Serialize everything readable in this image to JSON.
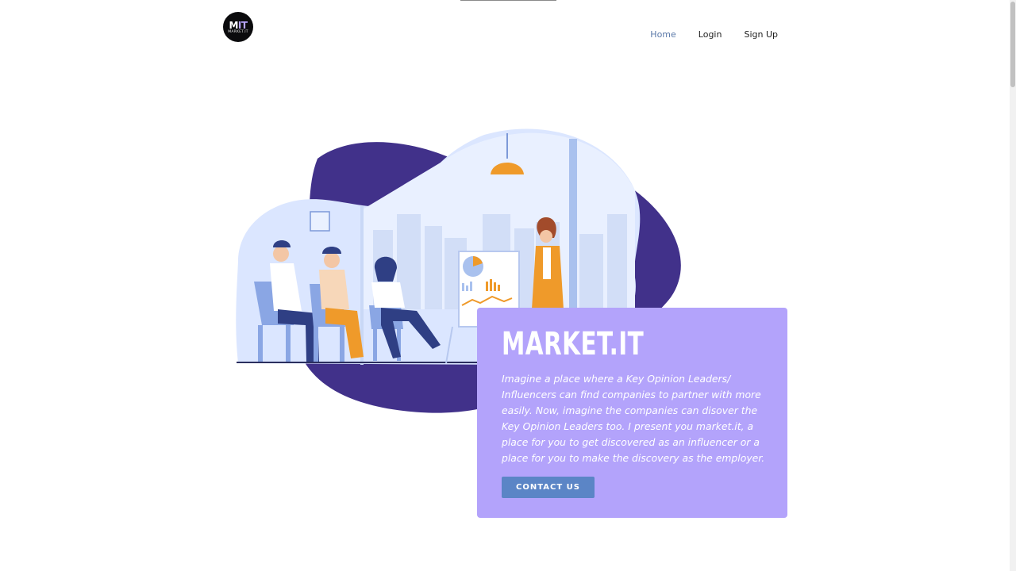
{
  "logo": {
    "mark_left": "M",
    "mark_right": "IT",
    "text": "MARKET.IT"
  },
  "nav": {
    "items": [
      {
        "label": "Home",
        "active": true
      },
      {
        "label": "Login",
        "active": false
      },
      {
        "label": "Sign Up",
        "active": false
      }
    ]
  },
  "hero": {
    "title": "MARKET.IT",
    "description": "Imagine a place where a Key Opinion Leaders/ Influencers can find companies to partner with more easily. Now, imagine the companies can disover the Key Opinion Leaders too. I present you market.it, a place for you to get discovered as an influencer or a place for you to make the discovery as the employer.",
    "cta_label": "CONTACT US"
  },
  "illustration": {
    "description_icon": "team-meeting-presentation-illustration"
  },
  "colors": {
    "card_bg": "#b3a3fb",
    "cta_bg": "#5b85c6",
    "nav_active": "#5b79a9",
    "blob_dark": "#41318a",
    "blob_light": "#d5e1ff"
  }
}
